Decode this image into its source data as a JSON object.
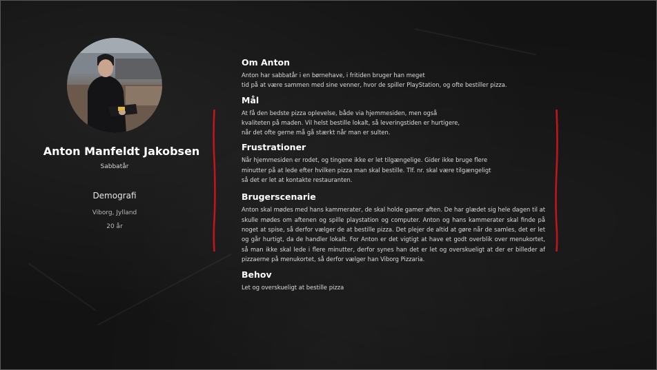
{
  "profile": {
    "name": "Anton Manfeldt Jakobsen",
    "role": "Sabbatår",
    "demographics": {
      "title": "Demografi",
      "location": "Viborg, Jylland",
      "age": "20 år"
    }
  },
  "sections": {
    "about": {
      "title": "Om Anton",
      "lines": [
        "Anton har sabbatår i en børnehave, i fritiden bruger han meget",
        "tid på at være sammen med sine venner, hvor de spiller PlayStation, og ofte bestiller pizza."
      ]
    },
    "goals": {
      "title": "Mål",
      "lines": [
        "At få den bedste pizza oplevelse, både via hjemmesiden, men også",
        "kvaliteten på maden. Vil helst bestille lokalt, så leveringstiden er hurtigere,",
        "når det ofte gerne må gå stærkt når man er sulten."
      ]
    },
    "frustrations": {
      "title": "Frustrationer",
      "lines": [
        "Når hjemmesiden er rodet, og tingene ikke er let tilgængelige. Gider ikke bruge flere",
        "minutter på at lede efter hvilken pizza man skal bestille. Tlf. nr. skal være tilgængeligt",
        "så det er let at kontakte restauranten."
      ]
    },
    "scenario": {
      "title": "Brugerscenarie",
      "text": "Anton skal mødes med hans kammerater, de skal holde gamer aften. De har glædet sig hele dagen til at skulle mødes om aftenen og spille playstation og computer. Anton og hans kammerater skal finde på noget at spise, så derfor vælger de at bestille pizza. Det plejer de altid at gøre når de samles, det er let og går hurtigt, da de handler lokalt. For Anton er det vigtigt at have et godt overblik over menukortet, så man ikke skal lede i flere minutter, derfor synes han det er let og overskueligt at der er billeder af pizzaerne på menukortet, så derfor vælger han Viborg Pizzaria."
    },
    "needs": {
      "title": "Behov",
      "lines": [
        "Let og overskueligt at bestille pizza"
      ]
    }
  },
  "colors": {
    "background": "#131313",
    "accent_red": "#c0161c",
    "heading": "#ffffff",
    "body_text": "#dcdcdc"
  }
}
